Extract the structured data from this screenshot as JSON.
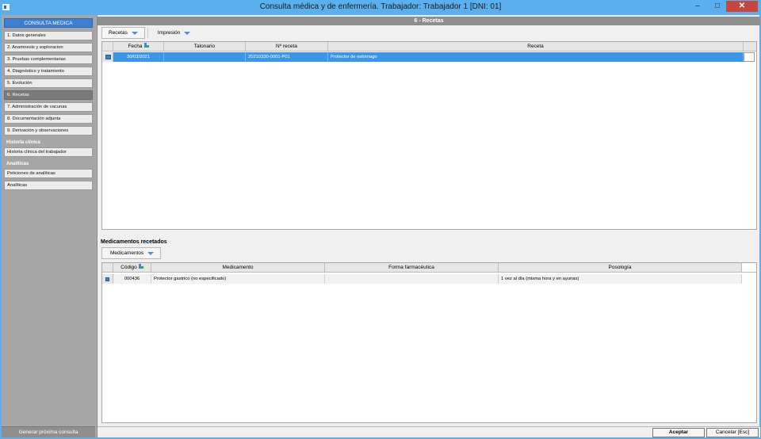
{
  "window": {
    "title": "Consulta médica y de enfermería. Trabajador: Trabajador 1 [DNI: 01]",
    "minimize": "–",
    "maximize": "□",
    "close": "✕"
  },
  "sidebar": {
    "header": "CONSULTA MEDICA",
    "items": [
      {
        "label": "1. Datos generales",
        "active": false
      },
      {
        "label": "2. Anamnesis y exploracion",
        "active": false
      },
      {
        "label": "3. Pruebas complementarias",
        "active": false
      },
      {
        "label": "4. Diagnóstico y tratamiento",
        "active": false
      },
      {
        "label": "5. Evolución",
        "active": false
      },
      {
        "label": "6. Recetas",
        "active": true
      },
      {
        "label": "7. Administración de vacunas",
        "active": false
      },
      {
        "label": "8. Documentación adjunta",
        "active": false
      },
      {
        "label": "9. Derivación y observaciones",
        "active": false
      }
    ],
    "historia_title": "Historia clínica",
    "historia_items": [
      "Historia clínica del trabajador"
    ],
    "analiticas_title": "Analíticas",
    "analiticas_items": [
      "Peticiones de analíticas",
      "Analíticas"
    ],
    "footer_button": "Generar próxima consulta"
  },
  "main": {
    "section_title": "6 - Recetas",
    "toolbar": {
      "recetas": "Recetas",
      "impresion": "Impresión"
    },
    "recetas_grid": {
      "columns": [
        "Fecha",
        "Talonario",
        "Nº receta",
        "Receta"
      ],
      "rows": [
        {
          "fecha": "30/03/2021",
          "talonario": "",
          "numero": "20210330-0001-P01",
          "receta": "Protector de estomago"
        }
      ]
    },
    "medicamentos": {
      "title": "Medicamentos recetados",
      "toolbar_button": "Medicamentos",
      "columns": [
        "Código",
        "Medicamento",
        "Forma farmacéutica",
        "Posología"
      ],
      "rows": [
        {
          "codigo": "000436",
          "medicamento": "Protector gastrico (no especificado)",
          "forma": "",
          "posologia": "1 vez al día (misma hora y en ayunas)"
        }
      ]
    }
  },
  "footer": {
    "accept": "Aceptar",
    "cancel": "Cancelar [Esc]"
  }
}
